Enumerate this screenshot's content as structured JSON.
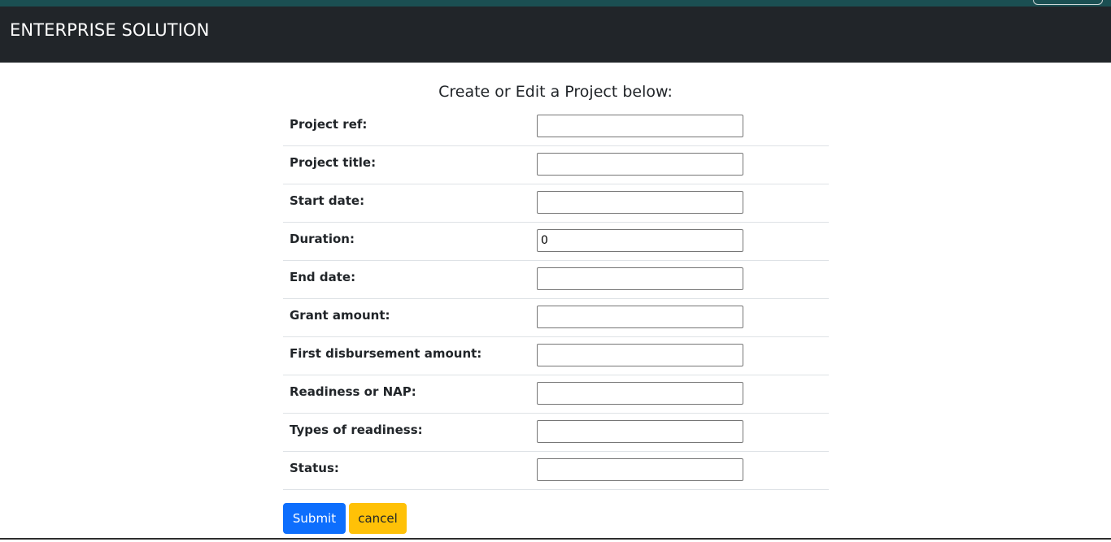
{
  "navbar": {
    "brand": "ENTERPRISE SOLUTION"
  },
  "form": {
    "heading": "Create or Edit a Project below:",
    "fields": [
      {
        "label": "Project ref:",
        "value": ""
      },
      {
        "label": "Project title:",
        "value": ""
      },
      {
        "label": "Start date:",
        "value": ""
      },
      {
        "label": "Duration:",
        "value": "0"
      },
      {
        "label": "End date:",
        "value": ""
      },
      {
        "label": "Grant amount:",
        "value": ""
      },
      {
        "label": "First disbursement amount:",
        "value": ""
      },
      {
        "label": "Readiness or NAP:",
        "value": ""
      },
      {
        "label": "Types of readiness:",
        "value": ""
      },
      {
        "label": "Status:",
        "value": ""
      }
    ],
    "submit_label": "Submit",
    "cancel_label": "cancel"
  },
  "colors": {
    "navbar_bg": "#212529",
    "submit_bg": "#0d6efd",
    "cancel_bg": "#ffc107"
  }
}
